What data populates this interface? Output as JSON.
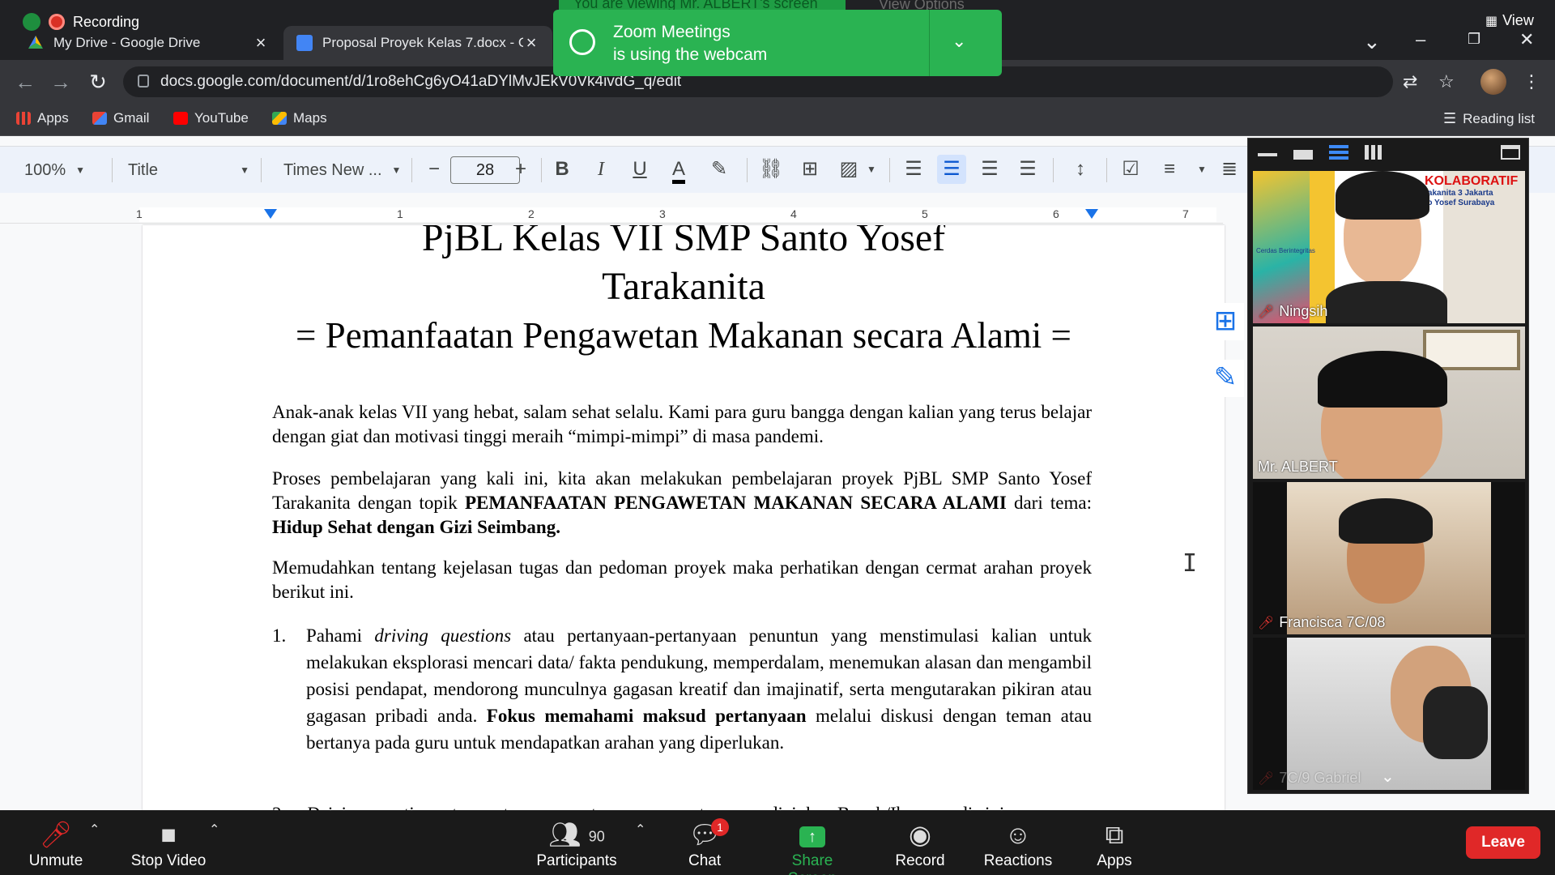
{
  "browser": {
    "recording_label": "Recording",
    "tabs": [
      {
        "title": "My Drive - Google Drive"
      },
      {
        "title": "Proposal Proyek Kelas 7.docx - G"
      }
    ],
    "url": "docs.google.com/document/d/1ro8ehCg6yO41aDYlMvJEkV0Vk4ivdG_q/edit",
    "view_label": "View",
    "bookmarks": [
      "Apps",
      "Gmail",
      "YouTube",
      "Maps"
    ],
    "reading_list": "Reading list"
  },
  "zoom_notification": {
    "line1": "Zoom Meetings",
    "line2": "is using the webcam",
    "viewing_banner": "You are viewing Mr. ALBERT's screen",
    "view_options": "View Options"
  },
  "docs_toolbar": {
    "zoom": "100%",
    "style": "Title",
    "font": "Times New ...",
    "font_size": "28"
  },
  "ruler": {
    "numbers": [
      "1",
      "1",
      "2",
      "3",
      "4",
      "5",
      "6",
      "7"
    ]
  },
  "document": {
    "title_line1": "PjBL Kelas VII SMP Santo Yosef",
    "title_line2": "Tarakanita",
    "subtitle": "= Pemanfaatan Pengawetan Makanan secara Alami =",
    "para1": "Anak-anak kelas VII yang hebat, salam sehat selalu. Kami para guru bangga dengan kalian yang terus belajar dengan giat dan motivasi tinggi meraih “mimpi-mimpi” di masa pandemi.",
    "para2_a": "Proses pembelajaran yang kali ini, kita akan melakukan pembelajaran proyek PjBL SMP Santo Yosef Tarakanita dengan topik ",
    "para2_b": "PEMANFAATAN PENGAWETAN MAKANAN SECARA ALAMI",
    "para2_c": " dari tema: ",
    "para2_d": "Hidup Sehat dengan Gizi Seimbang.",
    "para3": "Memudahkan tentang kejelasan tugas dan pedoman proyek maka perhatikan dengan cermat arahan proyek berikut ini.",
    "list": [
      {
        "num": "1.",
        "a": "Pahami ",
        "b": "driving questions",
        "c": " atau pertanyaan-pertanyaan penuntun yang menstimulasi kalian untuk melakukan eksplorasi mencari data/ fakta pendukung, memperdalam, menemukan alasan dan mengambil posisi pendapat, mendorong munculnya gagasan kreatif dan imajinatif, serta mengutarakan pikiran atau gagasan pribadi anda. ",
        "d": "Fokus memahami maksud pertanyaan",
        "e": " melalui diskusi dengan teman atau bertanya pada guru untuk mendapatkan arahan yang diperlukan."
      },
      {
        "num": "2.",
        "a": "",
        "b": "Driving questions",
        "c": " atau pertanyaan-pertanyaan penuntun yang diajukan Bapak/Ibu guru di sini",
        "d": "",
        "e": ""
      }
    ]
  },
  "gallery": {
    "participants": [
      {
        "name": "Ningsih",
        "muted": true,
        "banner": "KOLABORATIF",
        "banner_sub1": "rakanita 3 Jakarta",
        "banner_sub2": "to Yosef Surabaya",
        "corner": "Cerdas Berintegritas"
      },
      {
        "name": "Mr. ALBERT",
        "muted": false
      },
      {
        "name": "Francisca 7C/08",
        "muted": true
      },
      {
        "name": "7C/9 Gabriel",
        "muted": true
      }
    ]
  },
  "meeting_bar": {
    "unmute": "Unmute",
    "stop_video": "Stop Video",
    "participants": "Participants",
    "participants_count": "90",
    "chat": "Chat",
    "chat_badge": "1",
    "share_screen": "Share Screen",
    "record": "Record",
    "reactions": "Reactions",
    "apps": "Apps",
    "leave": "Leave"
  },
  "colors": {
    "zoom_green": "#2ab352",
    "leave_red": "#e02828",
    "docs_blue": "#1a73e8"
  }
}
